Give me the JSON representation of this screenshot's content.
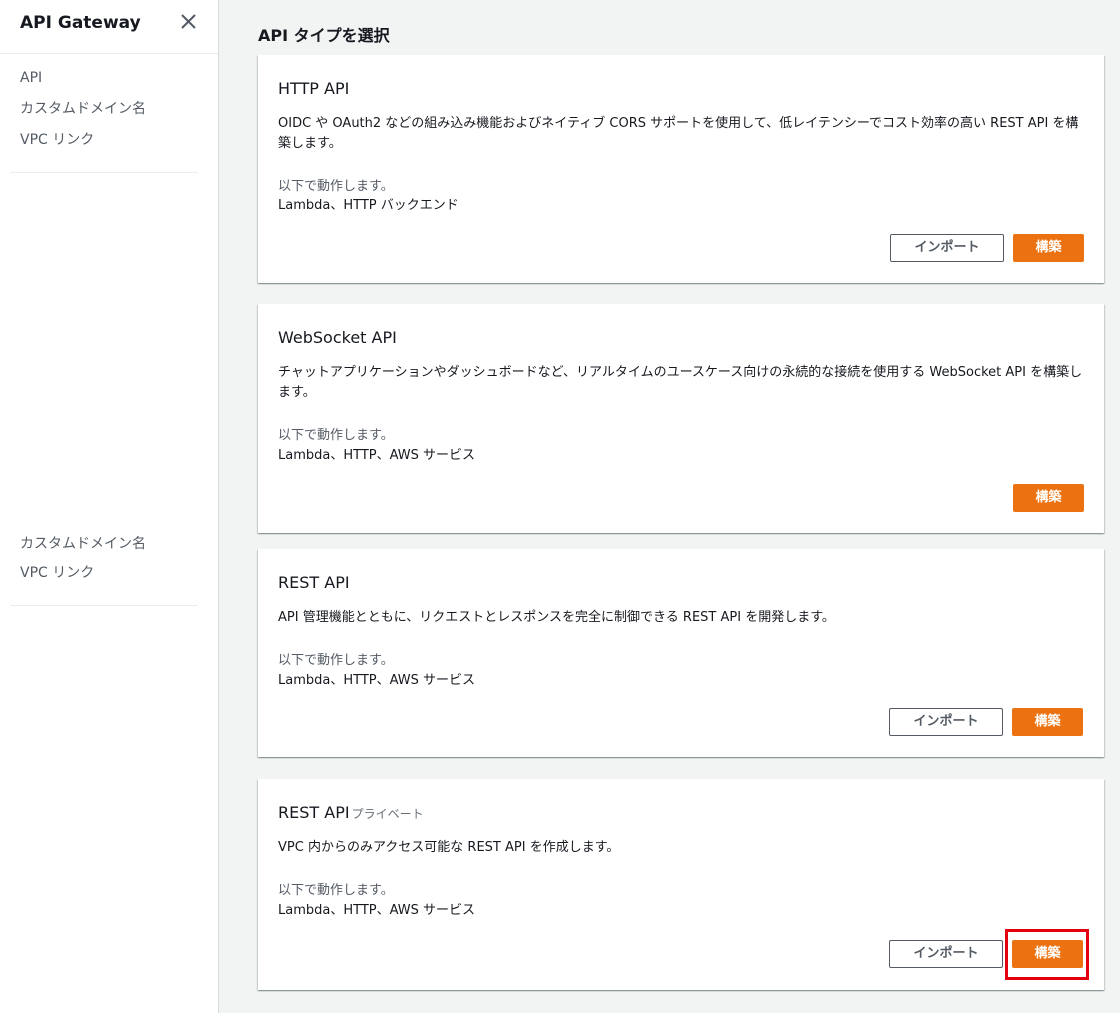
{
  "sidebar": {
    "title": "API Gateway",
    "items_top": [
      {
        "label": "API"
      },
      {
        "label": "カスタムドメイン名"
      },
      {
        "label": "VPC リンク"
      }
    ],
    "items_bottom": [
      {
        "label": "カスタムドメイン名"
      },
      {
        "label": "VPC リンク"
      }
    ]
  },
  "main": {
    "heading": "API タイプを選択",
    "works_with_label": "以下で動作します。",
    "cards": [
      {
        "title": "HTTP API",
        "title_suffix": "",
        "description": "OIDC や OAuth2 などの組み込み機能およびネイティブ CORS サポートを使用して、低レイテンシーでコスト効率の高い REST API を構築します。",
        "works_with": "Lambda、HTTP バックエンド",
        "import_label": "インポート",
        "build_label": "構築"
      },
      {
        "title": "WebSocket API",
        "title_suffix": "",
        "description": "チャットアプリケーションやダッシュボードなど、リアルタイムのユースケース向けの永続的な接続を使用する WebSocket API を構築します。",
        "works_with": "Lambda、HTTP、AWS サービス",
        "import_label": "",
        "build_label": "構築"
      },
      {
        "title": "REST API",
        "title_suffix": "",
        "description": "API 管理機能とともに、リクエストとレスポンスを完全に制御できる REST API を開発します。",
        "works_with": "Lambda、HTTP、AWS サービス",
        "import_label": "インポート",
        "build_label": "構築"
      },
      {
        "title": "REST API",
        "title_suffix": "プライベート",
        "description": "VPC 内からのみアクセス可能な REST API を作成します。",
        "works_with": "Lambda、HTTP、AWS サービス",
        "import_label": "インポート",
        "build_label": "構築"
      }
    ]
  },
  "colors": {
    "primary_button": "#ec7211",
    "highlight": "#e3000f",
    "background": "#f2f3f3"
  },
  "icons": {
    "close": "close-icon"
  }
}
